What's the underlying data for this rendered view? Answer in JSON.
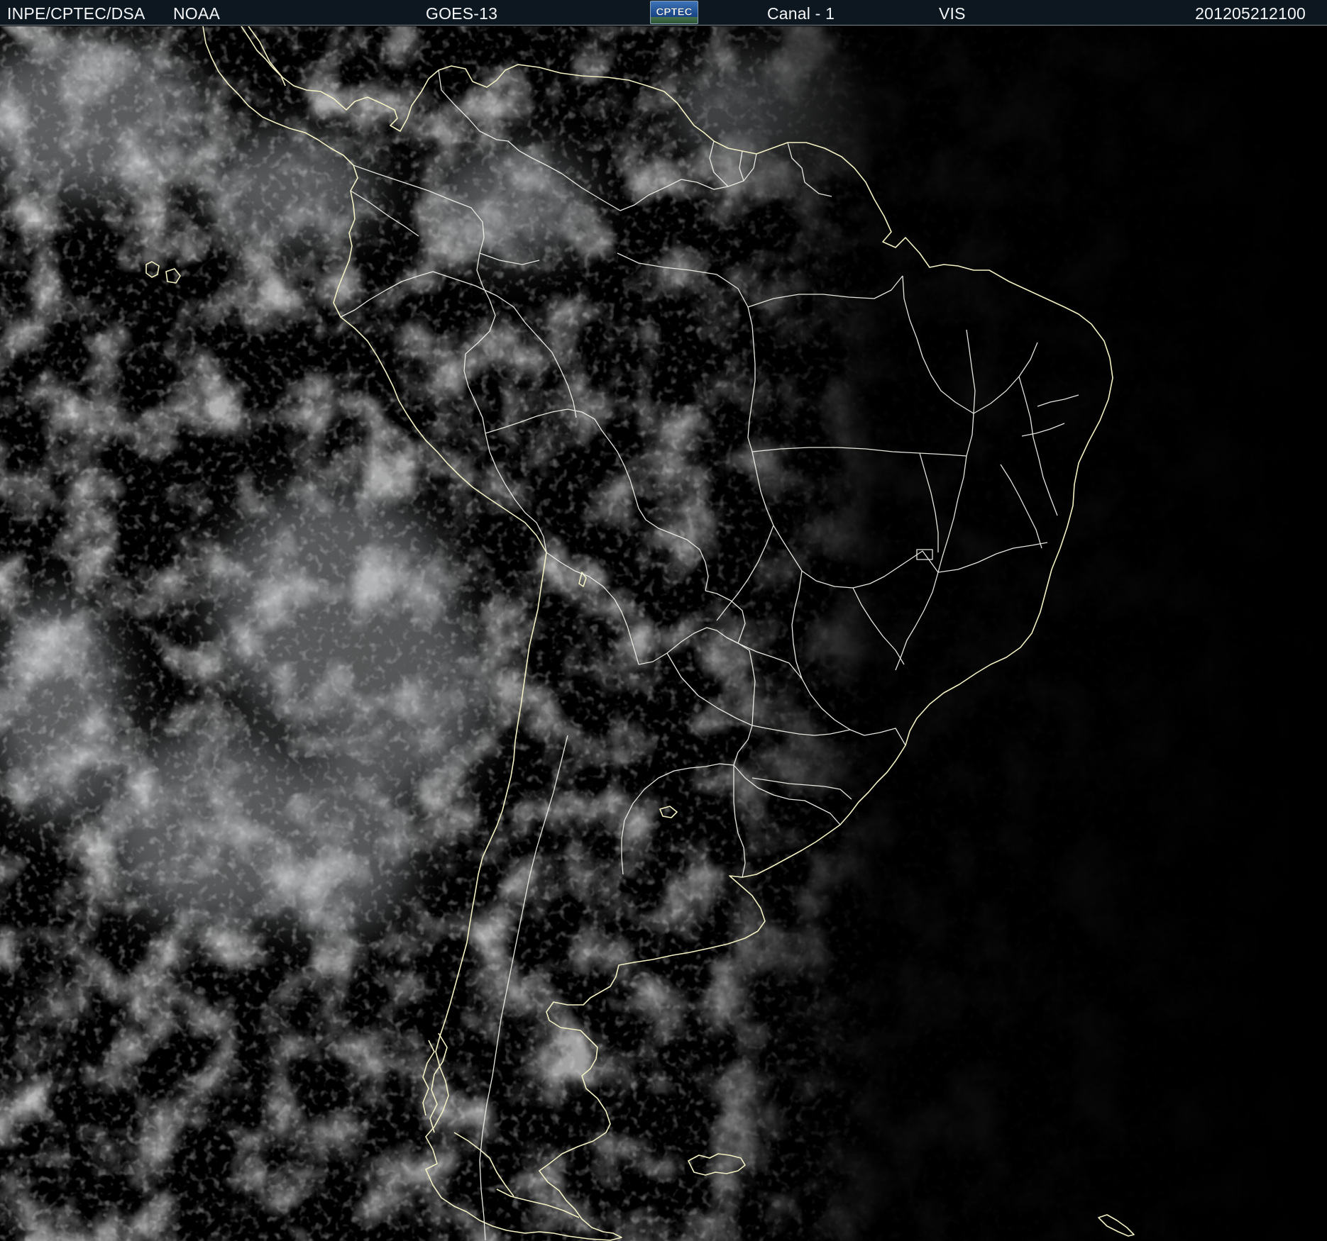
{
  "header": {
    "agency": "INPE/CPTEC/DSA",
    "source": "NOAA",
    "satellite": "GOES-13",
    "logo_text": "CPTEC",
    "channel": "Canal - 1",
    "band": "VIS",
    "timestamp": "201205212100"
  },
  "image": {
    "type": "visible satellite image",
    "region": "South America",
    "cloud_color": "#d9dde0",
    "coastline_color": "#f3f1c4",
    "border_color": "#f1f1ea",
    "background": "#000000"
  }
}
